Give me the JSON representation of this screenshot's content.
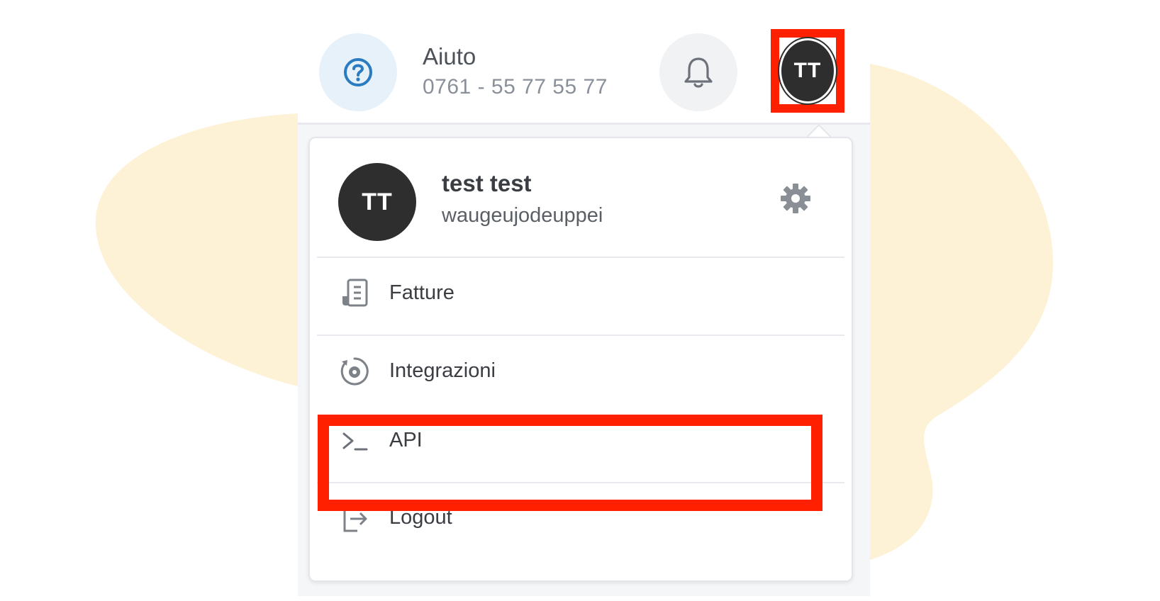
{
  "header": {
    "help_title": "Aiuto",
    "help_phone": "0761 - 55 77 55 77",
    "avatar_initials": "TT"
  },
  "profile": {
    "initials": "TT",
    "name": "test test",
    "username": "waugeujodeuppei"
  },
  "menu": {
    "items": [
      {
        "label": "Fatture",
        "icon": "invoice-icon"
      },
      {
        "label": "Integrazioni",
        "icon": "integration-icon"
      },
      {
        "label": "API",
        "icon": "terminal-icon"
      },
      {
        "label": "Logout",
        "icon": "logout-icon"
      }
    ]
  },
  "colors": {
    "highlight": "#ff2000",
    "blob": "#fdf2d6",
    "help_accent": "#2a7bbf",
    "avatar_bg": "#2e2e2e"
  }
}
